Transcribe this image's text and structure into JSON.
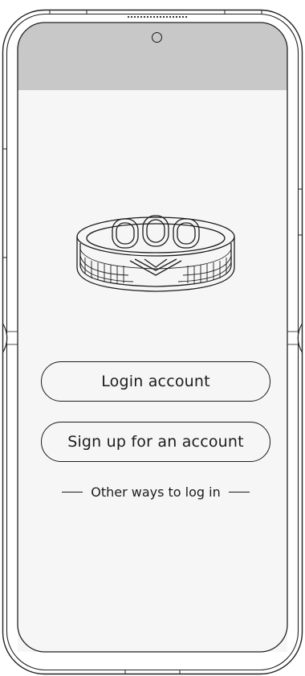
{
  "device": {
    "status_bar_color": "#c8c8c8",
    "screen_color": "#f6f6f6",
    "camera_icon": "front-camera-icon"
  },
  "hero": {
    "icon": "smart-ring-illustration"
  },
  "actions": {
    "login_label": "Login account",
    "signup_label": "Sign up for an account"
  },
  "alt_login": {
    "label": "Other ways to log in"
  }
}
